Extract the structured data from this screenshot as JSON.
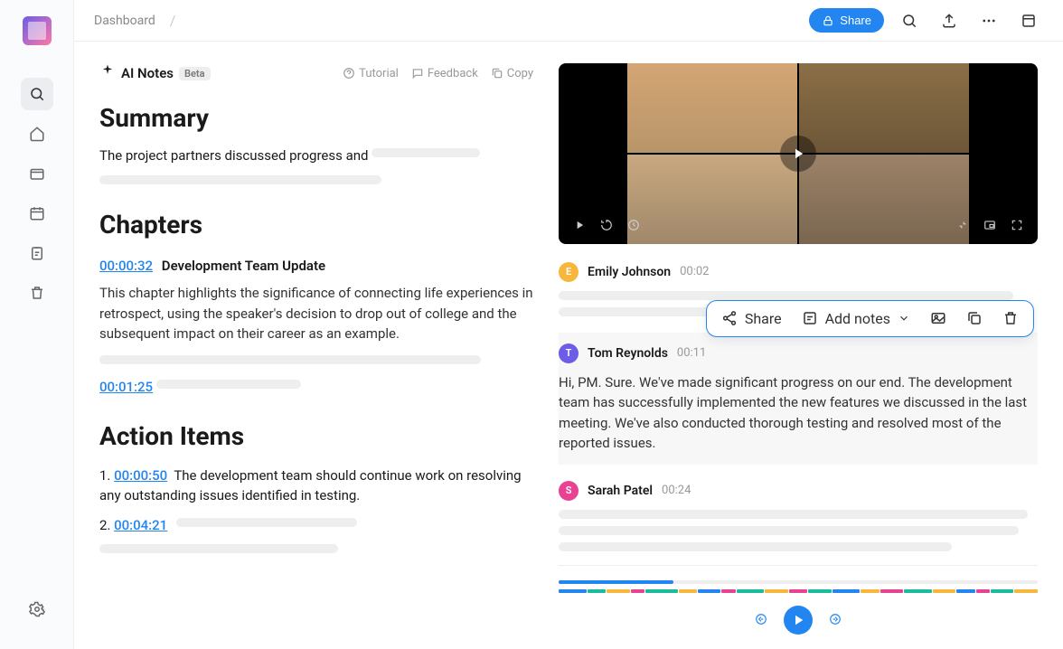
{
  "breadcrumb": "Dashboard",
  "topbar": {
    "share": "Share"
  },
  "ai_notes": {
    "title": "AI Notes",
    "badge": "Beta",
    "tutorial": "Tutorial",
    "feedback": "Feedback",
    "copy": "Copy"
  },
  "summary": {
    "heading": "Summary",
    "text": "The  project partners discussed progress and"
  },
  "chapters": {
    "heading": "Chapters",
    "items": [
      {
        "ts": "00:00:32",
        "title": "Development Team Update",
        "body": "This chapter highlights the significance of connecting life experiences in retrospect, using the speaker's decision to drop out of college and the subsequent impact on their career as an example."
      },
      {
        "ts": "00:01:25",
        "title": "",
        "body": ""
      }
    ]
  },
  "action_items": {
    "heading": "Action Items",
    "items": [
      {
        "num": "1.",
        "ts": "00:00:50",
        "body": "The development team should continue work on resolving any outstanding issues identified in testing."
      },
      {
        "num": "2.",
        "ts": "00:04:21",
        "body": ""
      }
    ]
  },
  "transcript": [
    {
      "initial": "E",
      "color": "#f6b73c",
      "name": "Emily Johnson",
      "time": "00:02",
      "body": ""
    },
    {
      "initial": "T",
      "color": "#6c5ce7",
      "name": "Tom Reynolds",
      "time": "00:11",
      "body": "Hi, PM. Sure. We've made significant progress on our end. The development team has successfully implemented the new features we discussed in the last meeting. We've also conducted thorough testing and resolved most of the reported issues."
    },
    {
      "initial": "S",
      "color": "#e84393",
      "name": "Sarah Patel",
      "time": "00:24",
      "body": ""
    }
  ],
  "floating": {
    "share": "Share",
    "add_notes": "Add notes"
  },
  "segments": [
    {
      "color": "#2285f0",
      "w": 6
    },
    {
      "color": "#1abc9c",
      "w": 4
    },
    {
      "color": "#f6b73c",
      "w": 5
    },
    {
      "color": "#e84393",
      "w": 3
    },
    {
      "color": "#1abc9c",
      "w": 7
    },
    {
      "color": "#f6b73c",
      "w": 4
    },
    {
      "color": "#2285f0",
      "w": 5
    },
    {
      "color": "#e84393",
      "w": 3
    },
    {
      "color": "#1abc9c",
      "w": 6
    },
    {
      "color": "#f6b73c",
      "w": 5
    },
    {
      "color": "#e84393",
      "w": 4
    },
    {
      "color": "#1abc9c",
      "w": 5
    },
    {
      "color": "#2285f0",
      "w": 6
    },
    {
      "color": "#f6b73c",
      "w": 4
    },
    {
      "color": "#e84393",
      "w": 5
    },
    {
      "color": "#1abc9c",
      "w": 6
    },
    {
      "color": "#f6b73c",
      "w": 5
    },
    {
      "color": "#2285f0",
      "w": 4
    },
    {
      "color": "#e84393",
      "w": 3
    },
    {
      "color": "#1abc9c",
      "w": 5
    },
    {
      "color": "#f6b73c",
      "w": 5
    }
  ]
}
